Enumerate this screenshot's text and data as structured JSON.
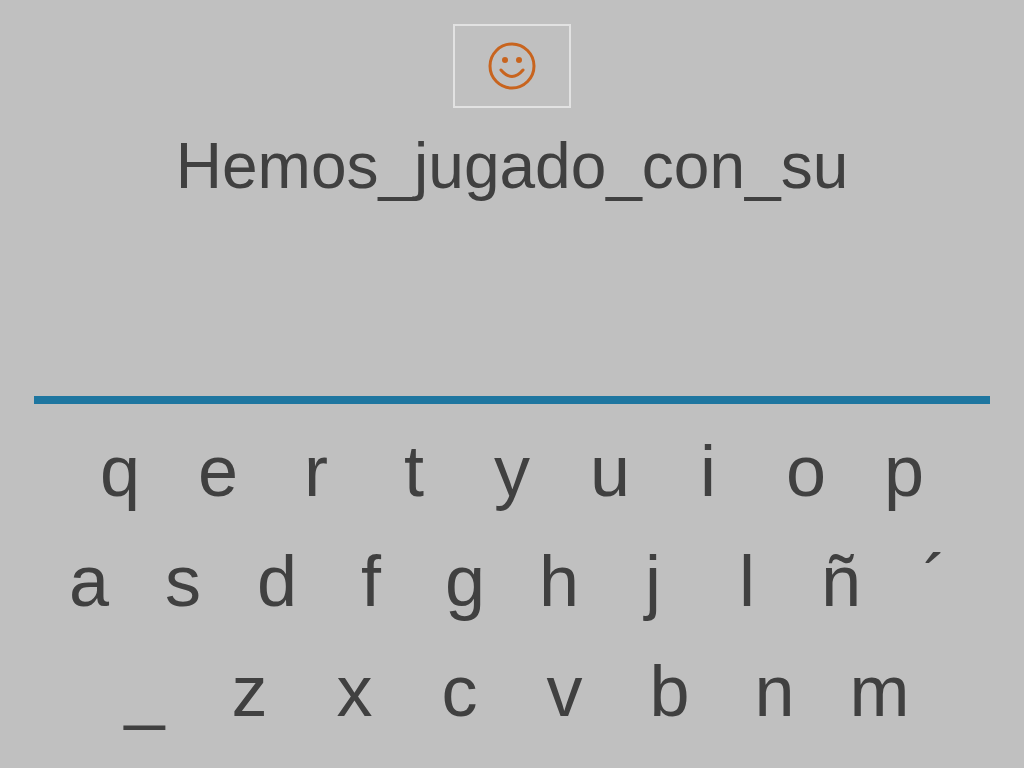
{
  "phrase": "Hemos_jugado_con_su",
  "keyboard": {
    "rows": [
      [
        "q",
        "e",
        "r",
        "t",
        "y",
        "u",
        "i",
        "o",
        "p"
      ],
      [
        "a",
        "s",
        "d",
        "f",
        "g",
        "h",
        "j",
        "l",
        "ñ",
        "´"
      ],
      [
        "_",
        "z",
        "x",
        "c",
        "v",
        "b",
        "n",
        "m"
      ]
    ]
  }
}
